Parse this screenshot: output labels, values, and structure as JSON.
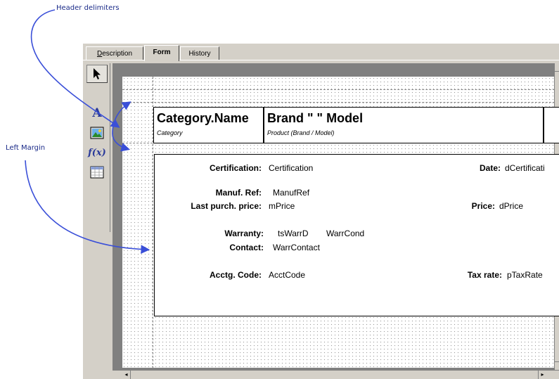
{
  "annotations": {
    "header_delimiters": "Header delimiters",
    "left_margin": "Left Margin"
  },
  "tabs": [
    {
      "label": "Description",
      "active": false
    },
    {
      "label": "Form",
      "active": true
    },
    {
      "label": "History",
      "active": false
    }
  ],
  "tools": [
    {
      "icon": "arrow-pointer-icon",
      "selected": true
    },
    {
      "icon": "text-tool-icon",
      "glyph": "A"
    },
    {
      "icon": "picture-tool-icon"
    },
    {
      "icon": "formula-tool-icon",
      "glyph": "f(x)"
    },
    {
      "icon": "table-tool-icon"
    }
  ],
  "header": {
    "cell1_title": "Category.Name",
    "cell1_sub": "Category",
    "cell2_title": "Brand \" \" Model",
    "cell2_sub": "Product (Brand / Model)"
  },
  "detail": {
    "certification_label": "Certification:",
    "certification_value": "Certification",
    "date_label": "Date:",
    "date_value": "dCertificati",
    "manuf_ref_label": "Manuf. Ref:",
    "manuf_ref_value": "ManufRef",
    "last_purch_label": "Last purch. price:",
    "last_purch_value": "mPrice",
    "price_label": "Price:",
    "price_value": "dPrice",
    "warranty_label": "Warranty:",
    "warranty_value1": "tsWarrD",
    "warranty_value2": "WarrCond",
    "contact_label": "Contact:",
    "contact_value": "WarrContact",
    "acctg_label": "Acctg. Code:",
    "acctg_value": "AcctCode",
    "tax_label": "Tax rate:",
    "tax_value": "pTaxRate"
  },
  "colors": {
    "annotation_arrow": "#3a4fd8",
    "annotation_text": "#1a2a88",
    "window_face": "#d4d0c8",
    "canvas_border": "#808080"
  }
}
